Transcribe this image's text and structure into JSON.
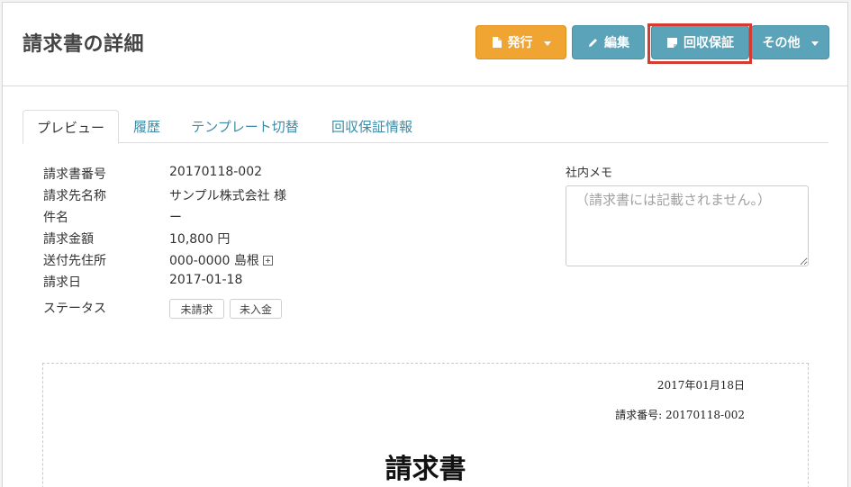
{
  "header": {
    "title": "請求書の詳細",
    "buttons": {
      "issue": "発行",
      "edit": "編集",
      "collection_guarantee": "回収保証",
      "other": "その他"
    }
  },
  "tabs": [
    {
      "label": "プレビュー",
      "active": true
    },
    {
      "label": "履歴",
      "active": false
    },
    {
      "label": "テンプレート切替",
      "active": false
    },
    {
      "label": "回収保証情報",
      "active": false
    }
  ],
  "details": {
    "invoice_number": {
      "label": "請求書番号",
      "value": "20170118-002"
    },
    "client_name": {
      "label": "請求先名称",
      "value": "サンプル株式会社 様"
    },
    "subject": {
      "label": "件名",
      "value": "ー"
    },
    "amount": {
      "label": "請求金額",
      "value": "10,800 円"
    },
    "address": {
      "label": "送付先住所",
      "value": "000-0000 島根"
    },
    "invoice_date": {
      "label": "請求日",
      "value": "2017-01-18"
    },
    "status": {
      "label": "ステータス",
      "badges": [
        "未請求",
        "未入金"
      ]
    }
  },
  "memo": {
    "label": "社内メモ",
    "placeholder": "（請求書には記載されません。）"
  },
  "document": {
    "date": "2017年01月18日",
    "number": "請求番号: 20170118-002",
    "title": "請求書"
  },
  "colors": {
    "orange": "#f0a431",
    "teal": "#5ba3b9",
    "highlight": "#d23c32",
    "link": "#3d8ba6"
  }
}
